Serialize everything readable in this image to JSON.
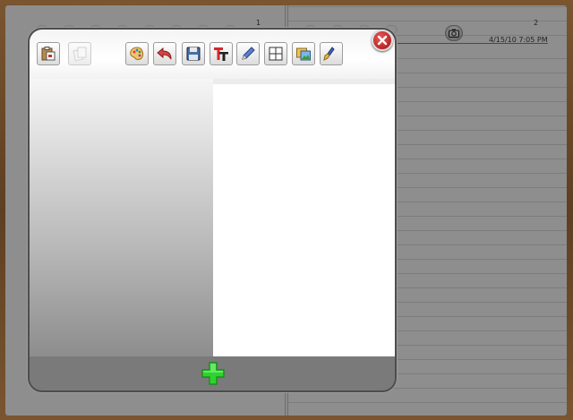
{
  "notebook": {
    "left_page_number": "1",
    "right_page_number": "2",
    "date_stamp": "4/15/10 7:05 PM"
  },
  "icons": {
    "camera": "camera-icon",
    "close": "close-icon",
    "add": "add-page-icon"
  },
  "toolbar": {
    "tools": [
      {
        "name": "paste-icon",
        "enabled": true
      },
      {
        "name": "copy-icon",
        "enabled": false
      },
      {
        "name": "palette-icon",
        "enabled": true
      },
      {
        "name": "undo-icon",
        "enabled": true
      },
      {
        "name": "save-icon",
        "enabled": true
      },
      {
        "name": "text-icon",
        "enabled": true
      },
      {
        "name": "pencil-icon",
        "enabled": true
      },
      {
        "name": "grid-icon",
        "enabled": true
      },
      {
        "name": "image-icon",
        "enabled": true
      },
      {
        "name": "brush-icon",
        "enabled": true
      }
    ]
  },
  "colors": {
    "close_button": "#c0392b",
    "add_button": "#22cc22",
    "page_gray": "#8e8e8e"
  }
}
